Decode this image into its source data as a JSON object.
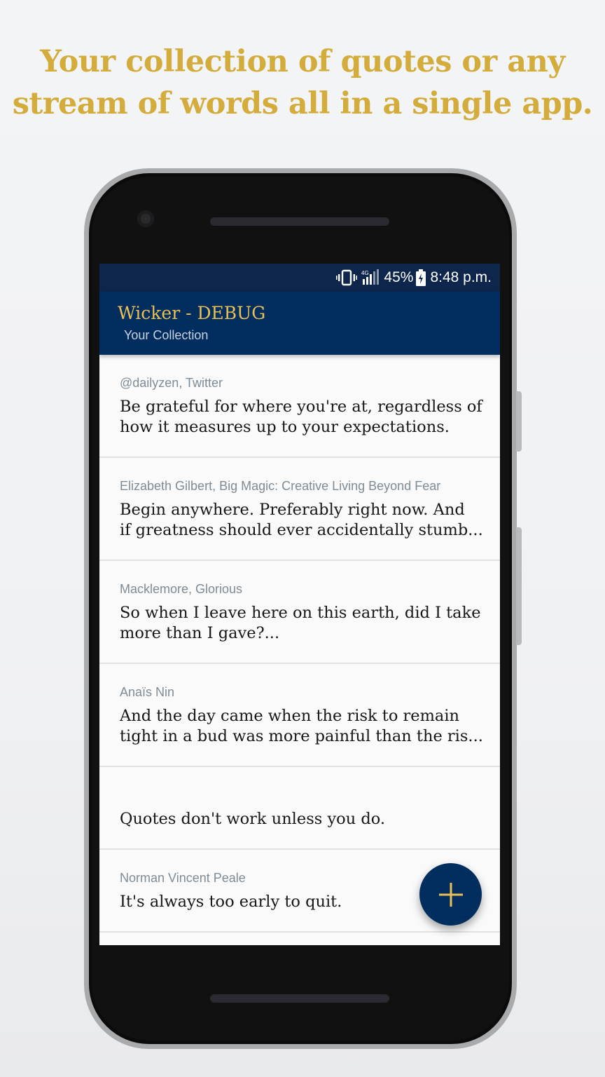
{
  "headline": {
    "line1": "Your collection of quotes or any",
    "line2": "stream of words all in a single app."
  },
  "status_bar": {
    "network": "4G",
    "battery": "45%",
    "time": "8:48 p.m."
  },
  "app_bar": {
    "title": "Wicker - DEBUG",
    "subtitle": "Your Collection"
  },
  "quotes": [
    {
      "author": "@dailyzen, Twitter",
      "lines": [
        "Be grateful for where you're at, regardless of",
        "how it measures up to your expectations."
      ]
    },
    {
      "author": "Elizabeth Gilbert, Big Magic: Creative Living Beyond Fear",
      "lines": [
        "Begin anywhere. Preferably right now. And",
        "if greatness should ever accidentally stumb..."
      ]
    },
    {
      "author": "Macklemore, Glorious",
      "lines": [
        "So when I leave here on this earth, did I take",
        "more than I gave?..."
      ]
    },
    {
      "author": "Anaïs Nin",
      "lines": [
        "And the day came when the risk to remain",
        "tight in a bud was more painful than the ris..."
      ]
    },
    {
      "author": "",
      "lines": [
        "Quotes don't work unless you do."
      ]
    },
    {
      "author": "Norman Vincent Peale",
      "lines": [
        "It's always too early to quit."
      ]
    }
  ],
  "fab": {
    "icon": "plus-icon"
  },
  "colors": {
    "headline": "#d3ac3c",
    "status_bar": "#0e264c",
    "app_bar": "#022d5f",
    "title": "#e8c055",
    "fab": "#022d5f",
    "fab_icon": "#e8c055"
  }
}
